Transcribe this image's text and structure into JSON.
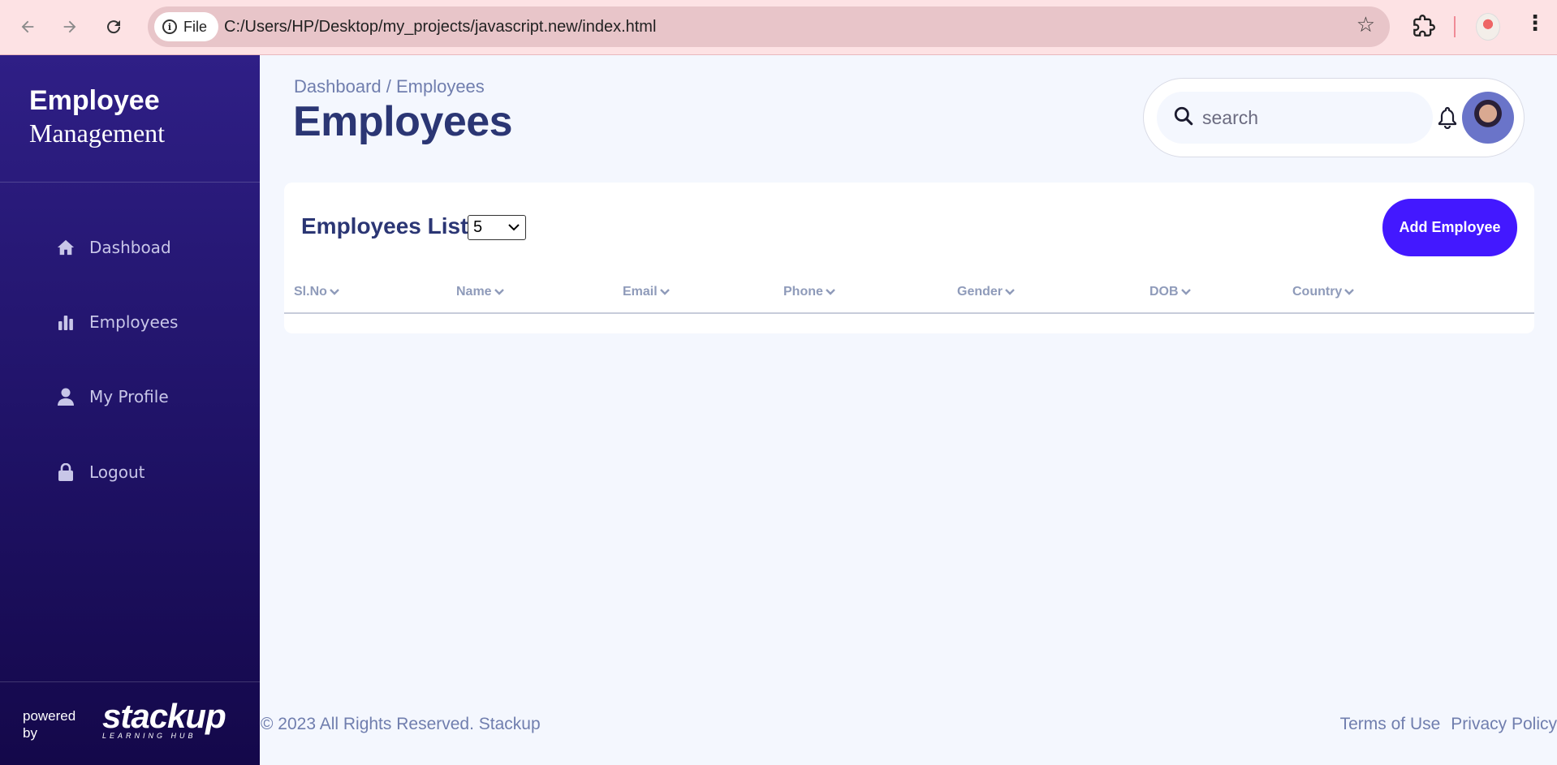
{
  "browser": {
    "file_label": "File",
    "url": "C:/Users/HP/Desktop/my_projects/javascript.new/index.html"
  },
  "sidebar": {
    "brand_top": "Employee",
    "brand_bottom": "Management",
    "items": [
      {
        "label": "Dashboad",
        "icon": "home-icon"
      },
      {
        "label": "Employees",
        "icon": "bar-chart-icon"
      },
      {
        "label": "My Profile",
        "icon": "user-icon"
      },
      {
        "label": "Logout",
        "icon": "lock-icon"
      }
    ],
    "powered_by": "powered by",
    "logo_word": "stackup",
    "logo_sub": "LEARNING HUB"
  },
  "header": {
    "breadcrumb": "Dashboard / Employees",
    "title": "Employees",
    "search_placeholder": "search"
  },
  "card": {
    "title": "Employees List",
    "page_size": "5",
    "add_button": "Add Employee",
    "columns": [
      "Sl.No",
      "Name",
      "Email",
      "Phone",
      "Gender",
      "DOB",
      "Country"
    ],
    "rows": []
  },
  "footer": {
    "copyright": "© 2023 All Rights Reserved. Stackup",
    "terms": "Terms of Use",
    "privacy": "Privacy Policy"
  },
  "colors": {
    "accent": "#4318ff",
    "title": "#2b3674",
    "muted": "#707eae",
    "sidebar_top": "#2f1f86",
    "sidebar_bottom": "#14084a"
  }
}
